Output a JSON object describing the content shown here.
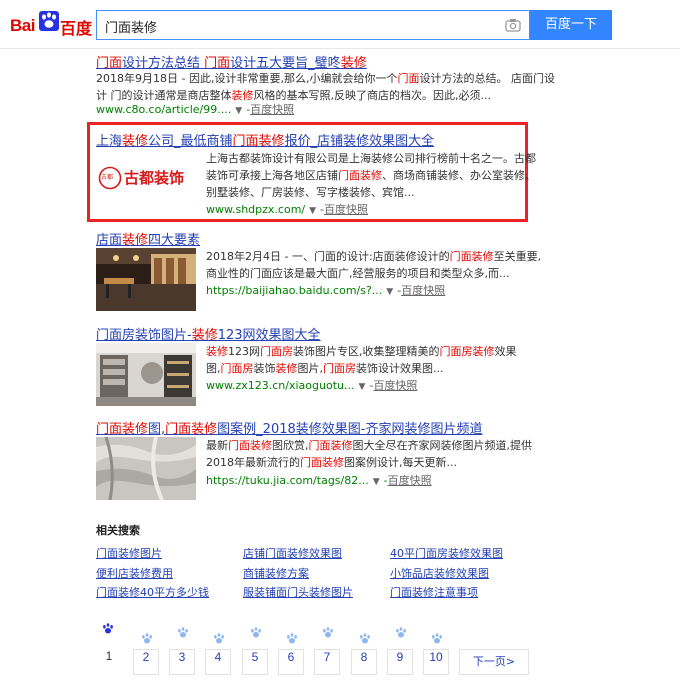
{
  "header": {
    "logo_latin": "Bai",
    "logo_cn": "百度",
    "query": "门面装修",
    "search_button": "百度一下"
  },
  "results": [
    {
      "title_parts": [
        [
          "门面",
          true
        ],
        [
          "设计方法总结 ",
          false
        ],
        [
          "门面",
          true
        ],
        [
          "设计五大要旨_璧咚",
          false
        ],
        [
          "装修",
          true
        ]
      ],
      "snippet_lines": [
        [
          [
            "2018年9月18日 - 因此,设计非常重要,那么,小编就会给你一个",
            false
          ],
          [
            "门面",
            true
          ],
          [
            "设计方法的总结。 店面门设",
            false
          ]
        ],
        [
          [
            "计 门的设计通常是商店整体",
            false
          ],
          [
            "装修",
            true
          ],
          [
            "风格的基本写照,反映了商店的档次。因此,必须...",
            false
          ]
        ]
      ],
      "url": "www.c8o.co/article/99....",
      "cache": "百度快照"
    },
    {
      "title_parts": [
        [
          "上海",
          false
        ],
        [
          "装修",
          true
        ],
        [
          "公司_最低商铺",
          false
        ],
        [
          "门面装修",
          true
        ],
        [
          "报价_店铺装修效果图大全",
          false
        ]
      ],
      "logo_text": "古都装饰",
      "logo_seal": "古都",
      "snippet_lines": [
        [
          [
            "上海古都装饰设计有限公司是上海装修公司排行榜前十名之一。古都",
            false
          ]
        ],
        [
          [
            "装饰可承接上海各地区店铺",
            false
          ],
          [
            "门面装修",
            true
          ],
          [
            "、商场商铺装修、办公室装修、",
            false
          ]
        ],
        [
          [
            "别墅装修、厂房装修、写字楼装修、宾馆...",
            false
          ]
        ]
      ],
      "url": "www.shdpzx.com/",
      "cache": "百度快照"
    },
    {
      "title_parts": [
        [
          "店面",
          false
        ],
        [
          "装修",
          true
        ],
        [
          "四大要素",
          false
        ]
      ],
      "snippet_lines": [
        [
          [
            "2018年2月4日 - 一、门面的设计:店面装修设计的",
            false
          ],
          [
            "门面装修",
            true
          ],
          [
            "至关重要,",
            false
          ]
        ],
        [
          [
            "商业性的门面应该是最大面广,经营服务的项目和类型众多,而...",
            false
          ]
        ]
      ],
      "url": "https://baijiahao.baidu.com/s?...",
      "cache": "百度快照"
    },
    {
      "title_parts": [
        [
          "门面房装饰图片-",
          false
        ],
        [
          "装修",
          true
        ],
        [
          "123网效果图大全",
          false
        ]
      ],
      "snippet_lines": [
        [
          [
            "装修",
            true
          ],
          [
            "123网",
            false
          ],
          [
            "门面房",
            true
          ],
          [
            "装饰图片专区,收集整理精美的",
            false
          ],
          [
            "门面房装修",
            true
          ],
          [
            "效果",
            false
          ]
        ],
        [
          [
            "图,",
            false
          ],
          [
            "门面房",
            true
          ],
          [
            "装饰",
            false
          ],
          [
            "装修",
            true
          ],
          [
            "图片,",
            false
          ],
          [
            "门面房",
            true
          ],
          [
            "装饰设计效果图...",
            false
          ]
        ]
      ],
      "url": "www.zx123.cn/xiaoguotu...",
      "cache": "百度快照"
    },
    {
      "title_parts": [
        [
          "门面装修",
          true
        ],
        [
          "图,",
          false
        ],
        [
          "门面装修",
          true
        ],
        [
          "图案例_2018装修效果图-齐家网装修图片频道",
          false
        ]
      ],
      "snippet_lines": [
        [
          [
            "最新",
            false
          ],
          [
            "门面装修",
            true
          ],
          [
            "图欣赏,",
            false
          ],
          [
            "门面装修",
            true
          ],
          [
            "图大全尽在齐家网装修图片频道,提供",
            false
          ]
        ],
        [
          [
            "2018年最新流行的",
            false
          ],
          [
            "门面装修",
            true
          ],
          [
            "图案例设计,每天更新...",
            false
          ]
        ]
      ],
      "url": "https://tuku.jia.com/tags/82...",
      "cache": "百度快照"
    }
  ],
  "related": {
    "title": "相关搜索",
    "items": [
      "门面装修图片",
      "店铺门面装修效果图",
      "40平门面房装修效果图",
      "便利店装修费用",
      "商铺装修方案",
      "小饰品店装修效果图",
      "门面装修40平方多少钱",
      "服装铺面门头装修图片",
      "门面装修注意事项"
    ]
  },
  "pagination": {
    "pages": [
      "1",
      "2",
      "3",
      "4",
      "5",
      "6",
      "7",
      "8",
      "9",
      "10"
    ],
    "next": "下一页>"
  },
  "colors": {
    "link": "#2440b3",
    "highlight": "#e10601",
    "url": "#008000",
    "brand": "#3385ff",
    "ad_frame": "#e22"
  }
}
